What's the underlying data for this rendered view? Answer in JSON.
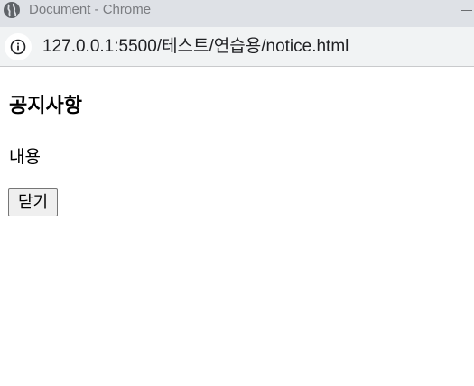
{
  "window": {
    "title": "Document - Chrome",
    "icon": "globe-icon"
  },
  "address_bar": {
    "info_icon": "info-icon",
    "url": "127.0.0.1:5500/테스트/연습용/notice.html"
  },
  "page": {
    "heading": "공지사항",
    "content": "내용",
    "close_button_label": "닫기"
  }
}
